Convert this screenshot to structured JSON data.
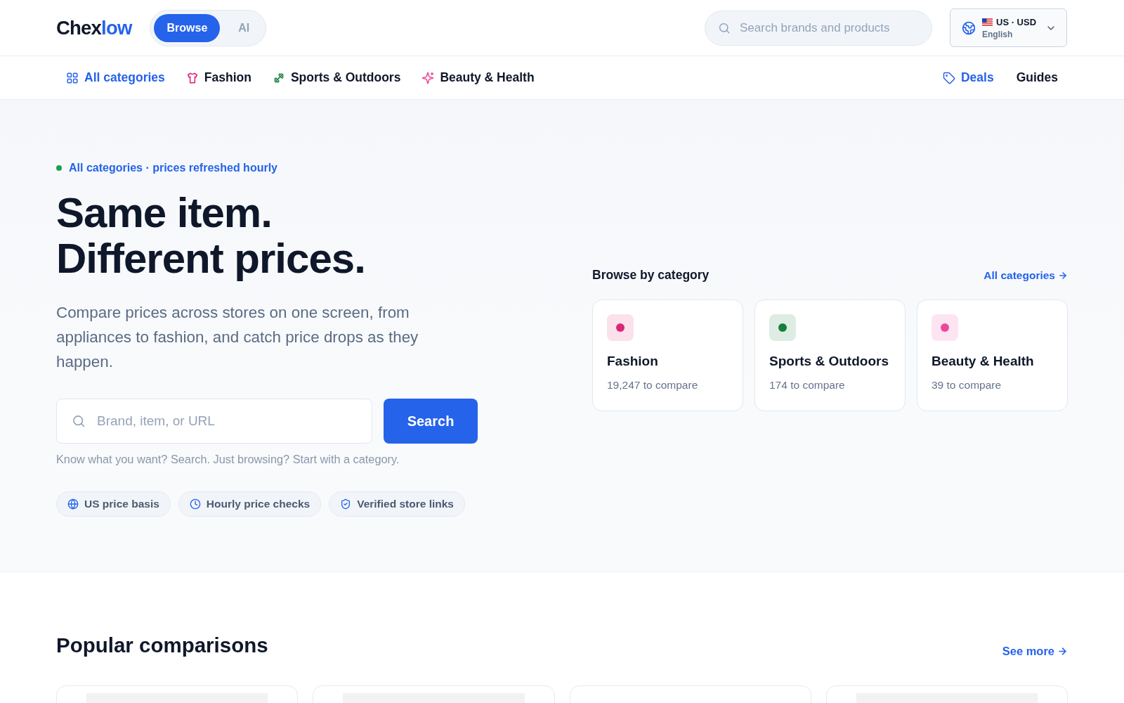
{
  "header": {
    "logo": {
      "main": "Chex",
      "accent": "low"
    },
    "mode_tabs": [
      {
        "label": "Browse",
        "selected": true
      },
      {
        "label": "AI",
        "selected": false
      }
    ],
    "search": {
      "placeholder": "Search brands and products"
    },
    "locale": {
      "region": "US · USD",
      "language": "English"
    }
  },
  "nav": {
    "categories": [
      {
        "label": "All categories",
        "selected": true
      },
      {
        "label": "Fashion",
        "selected": false
      },
      {
        "label": "Sports & Outdoors",
        "selected": false
      },
      {
        "label": "Beauty & Health",
        "selected": false
      }
    ],
    "links": [
      {
        "label": "Deals",
        "kind": "tagged"
      },
      {
        "label": "Guides",
        "kind": "plain"
      }
    ]
  },
  "hero": {
    "eyebrow": "All categories · prices refreshed hourly",
    "heading": [
      "Same item.",
      "Different prices."
    ],
    "description": "Compare prices across stores on one screen, from appliances to fashion, and catch price drops as they happen.",
    "search": {
      "placeholder": "Brand, item, or URL",
      "button": "Search"
    },
    "hint": "Know what you want? Search. Just browsing? Start with a category.",
    "features": [
      "US price basis",
      "Hourly price checks",
      "Verified store links"
    ]
  },
  "browse": {
    "title": "Browse by category",
    "link": "All categories",
    "cards": [
      {
        "name": "Fashion",
        "count": "19,247 to compare",
        "color": "#db2777"
      },
      {
        "name": "Sports & Outdoors",
        "count": "174 to compare",
        "color": "#15803d"
      },
      {
        "name": "Beauty & Health",
        "count": "39 to compare",
        "color": "#ec4899"
      }
    ]
  },
  "popular": {
    "title": "Popular comparisons",
    "link": "See more",
    "cards": [
      {
        "kind": "skeleton"
      },
      {
        "kind": "skeleton"
      },
      {
        "kind": "blank"
      },
      {
        "kind": "skeleton"
      }
    ]
  }
}
